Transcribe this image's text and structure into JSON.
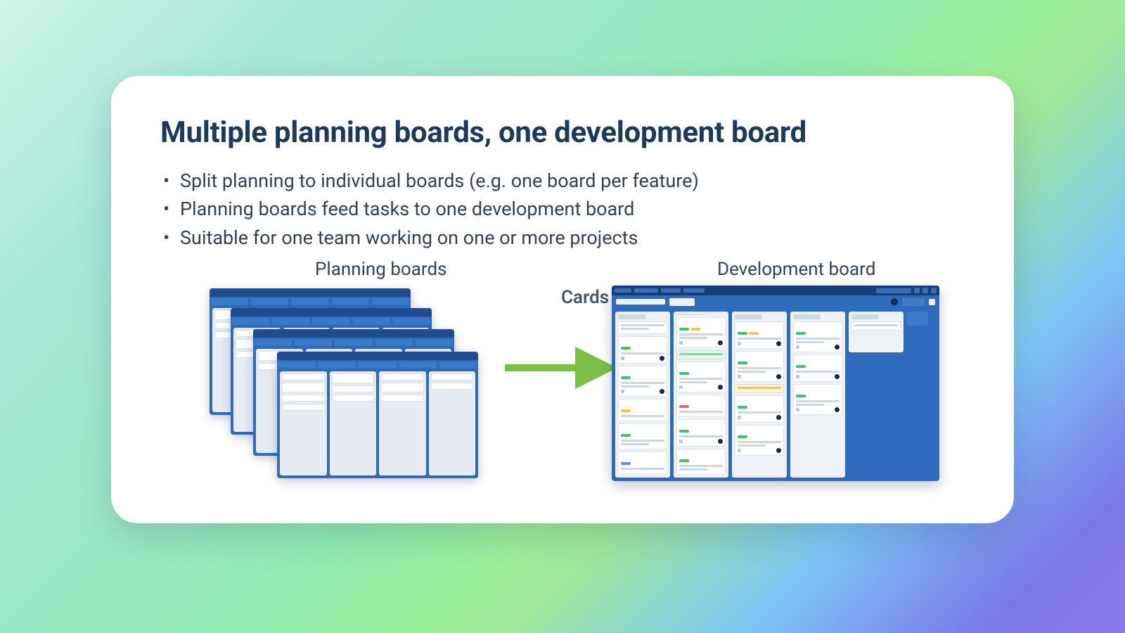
{
  "title": "Multiple planning boards, one development board",
  "bullets": [
    "Split planning to individual boards (e.g. one board per feature)",
    "Planning boards feed tasks to one development board",
    "Suitable for one team working on one or more projects"
  ],
  "labels": {
    "planning": "Planning boards",
    "development": "Development board",
    "arrow": "Cards"
  },
  "colors": {
    "arrow": "#7bc043",
    "board_bg": "#2f6bbd",
    "title": "#1d3a5c"
  }
}
